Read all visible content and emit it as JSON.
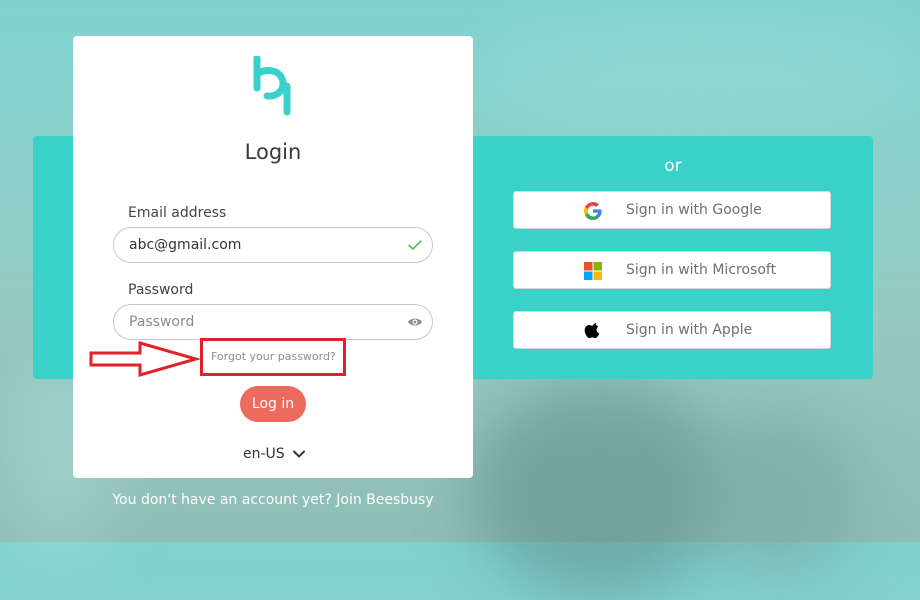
{
  "login": {
    "title": "Login",
    "email_label": "Email address",
    "email_value": "abc@gmail.com",
    "password_label": "Password",
    "password_placeholder": "Password",
    "forgot_link": "Forgot your password?",
    "login_button": "Log in",
    "language": "en-US",
    "signup_text": "You don't have an account yet? Join Beesbusy"
  },
  "sso": {
    "or_label": "or",
    "buttons": [
      {
        "label": "Sign in with Google",
        "icon": "google-icon"
      },
      {
        "label": "Sign in with Microsoft",
        "icon": "microsoft-icon"
      },
      {
        "label": "Sign in with Apple",
        "icon": "apple-icon"
      }
    ]
  },
  "colors": {
    "brand_teal": "#3ad1c9",
    "login_button": "#ec6a5e",
    "valid_check": "#5cb85c",
    "annotation_red": "#e0212a"
  }
}
